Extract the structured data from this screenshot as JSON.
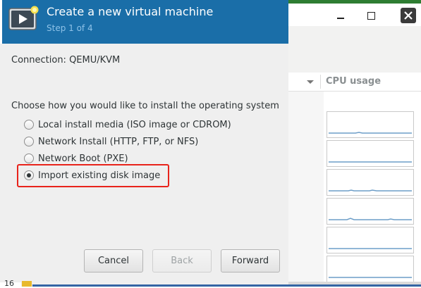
{
  "dialog": {
    "title": "Create a new virtual machine",
    "step": "Step 1 of 4",
    "connection": "Connection: QEMU/KVM",
    "install_prompt": "Choose how you would like to install the operating system",
    "install_options": [
      {
        "label": "Local install media (ISO image or CDROM)",
        "checked": false
      },
      {
        "label": "Network Install (HTTP, FTP, or NFS)",
        "checked": false
      },
      {
        "label": "Network Boot (PXE)",
        "checked": false
      },
      {
        "label": "Import existing disk image",
        "checked": true
      }
    ],
    "buttons": {
      "cancel": "Cancel",
      "back": "Back",
      "forward": "Forward"
    }
  },
  "background_window": {
    "column_header": "CPU usage"
  },
  "taskbar": {
    "workspace_number": "16"
  },
  "colors": {
    "header_blue": "#1a6ea8",
    "highlight_red": "#e8231b",
    "spark_line": "#6d9ec8"
  },
  "icons": [
    "vm-player-icon",
    "minimize-icon",
    "maximize-icon",
    "close-icon",
    "sort-down-icon"
  ]
}
